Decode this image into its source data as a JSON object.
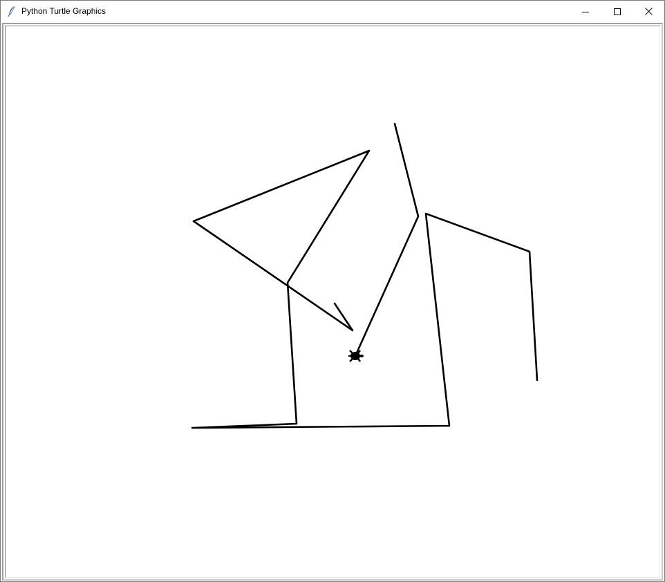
{
  "window": {
    "title": "Python Turtle Graphics",
    "icon": "feather-icon",
    "controls": {
      "minimize_icon": "minimize-icon",
      "maximize_icon": "maximize-icon",
      "close_icon": "close-icon"
    }
  },
  "canvas": {
    "background": "#ffffff",
    "pen_color": "#000000",
    "turtle_shape": "turtle",
    "turtle_heading": "east"
  }
}
